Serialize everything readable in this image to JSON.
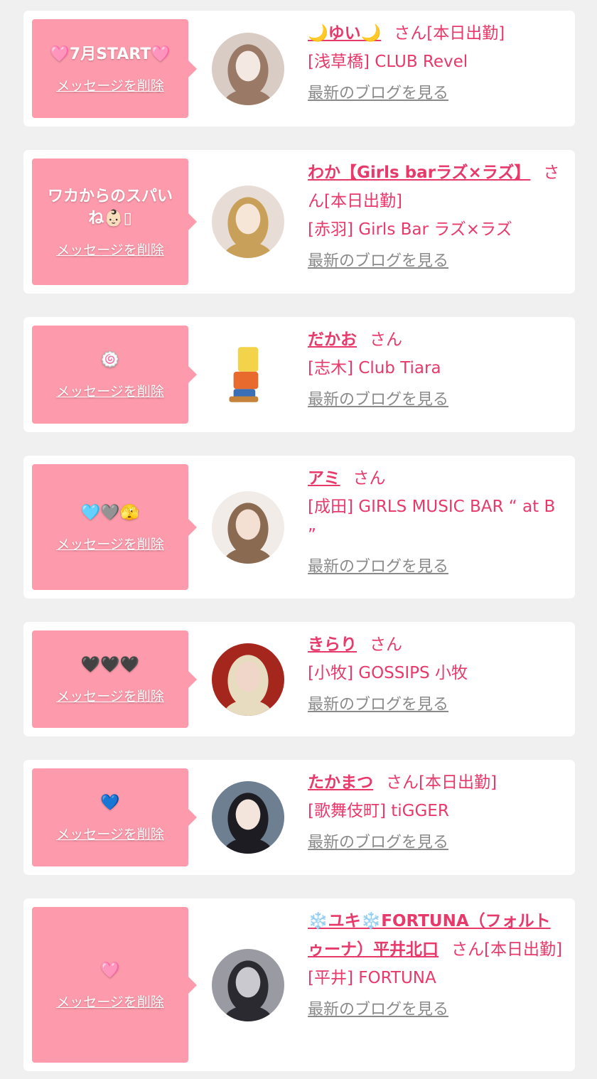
{
  "delete_label": "メッセージを削除",
  "blog_label": "最新のブログを見る",
  "san_suffix": "さん",
  "colors": {
    "page_bg": "#f0f0f0",
    "card_bg": "#ffffff",
    "bubble_bg": "#fd9aab",
    "accent": "#e8396b",
    "blog_link": "#8a8a8a"
  },
  "entries": [
    {
      "message": "🩷7月START🩷",
      "name": "🌙ゆい🌙",
      "status": "[本日出勤]",
      "shop": "[浅草橋] CLUB Revel",
      "avatar_icon": "photo-avatar",
      "avatar_palette": [
        "#d8ccc4",
        "#f3e8e2",
        "#9a7a66"
      ]
    },
    {
      "message": "ワカからのスパいね👶🏻▯",
      "name": "わか【Girls barラズ×ラズ】",
      "status": "[本日出勤]",
      "shop": "[赤羽] Girls Bar ラズ×ラズ",
      "avatar_icon": "photo-avatar",
      "avatar_palette": [
        "#e8ddd6",
        "#f6e6d8",
        "#c9a05a"
      ]
    },
    {
      "message": "🍥",
      "name": "だかお",
      "status": "",
      "shop": "[志木] Club Tiara",
      "avatar_icon": "cartoon-avatar",
      "avatar_palette": [
        "#ffffff",
        "#f2d34a",
        "#3b6fb5"
      ]
    },
    {
      "message": "🩵🩶🫣",
      "name": "アミ",
      "status": "",
      "shop": "[成田] GIRLS MUSIC BAR “ at B ”",
      "avatar_icon": "photo-avatar",
      "avatar_palette": [
        "#f1ece8",
        "#f4dfd3",
        "#8b6a52"
      ]
    },
    {
      "message": "🖤🖤🖤",
      "name": "きらり",
      "status": "",
      "shop": "[小牧] GOSSIPS 小牧",
      "avatar_icon": "photo-avatar",
      "avatar_palette": [
        "#a4261c",
        "#f0d6c8",
        "#e7dcc0"
      ]
    },
    {
      "message": "💙",
      "name": "たかまつ",
      "status": "[本日出勤]",
      "shop": "[歌舞伎町] tiGGER",
      "avatar_icon": "photo-avatar",
      "avatar_palette": [
        "#6d7f90",
        "#f3e4dc",
        "#1c1c22"
      ]
    },
    {
      "message": "🩷",
      "name": "❄️ユキ❄️FORTUNA（フォルトゥーナ）平井北口",
      "status": "[本日出勤]",
      "shop": "[平井] FORTUNA",
      "avatar_icon": "photo-avatar",
      "avatar_palette": [
        "#9a9aa2",
        "#c9c9cf",
        "#2a2a30"
      ]
    }
  ]
}
